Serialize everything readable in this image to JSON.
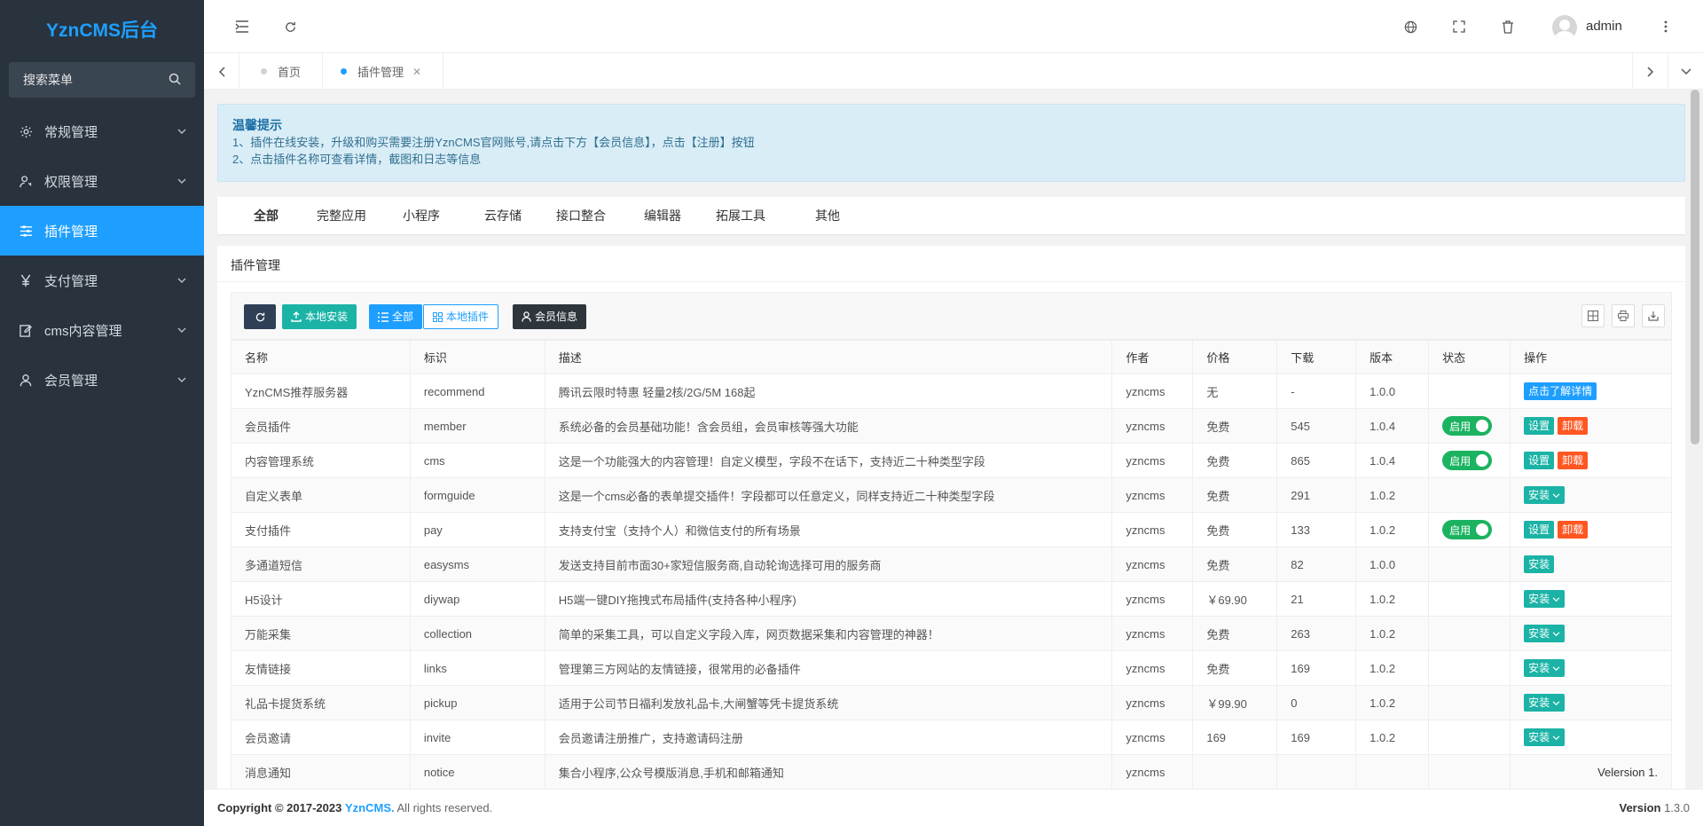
{
  "app": {
    "logo": "YznCMS后台"
  },
  "sidebar": {
    "search_placeholder": "搜索菜单",
    "items": [
      {
        "label": "常规管理",
        "icon": "gear-icon"
      },
      {
        "label": "权限管理",
        "icon": "user-key-icon"
      },
      {
        "label": "插件管理",
        "icon": "sliders-icon",
        "active": true
      },
      {
        "label": "支付管理",
        "icon": "yen-icon"
      },
      {
        "label": "cms内容管理",
        "icon": "edit-icon"
      },
      {
        "label": "会员管理",
        "icon": "user-icon"
      }
    ]
  },
  "header": {
    "user": "admin"
  },
  "tabs": [
    {
      "label": "首页"
    },
    {
      "label": "插件管理",
      "active": true
    }
  ],
  "notice": {
    "title": "温馨提示",
    "line1": "1、插件在线安装，升级和购买需要注册YznCMS官网账号,请点击下方【会员信息】，点击【注册】按钮",
    "line2": "2、点击插件名称可查看详情，截图和日志等信息"
  },
  "categories": [
    "全部",
    "完整应用",
    "小程序",
    "云存储",
    "接口整合",
    "编辑器",
    "拓展工具",
    "其他"
  ],
  "panel": {
    "title": "插件管理",
    "toolbar": {
      "local_install": "本地安装",
      "all": "全部",
      "local_plugins": "本地插件",
      "member_info": "会员信息"
    }
  },
  "table": {
    "headers": [
      "名称",
      "标识",
      "描述",
      "作者",
      "价格",
      "下载",
      "版本",
      "状态",
      "操作"
    ],
    "labels": {
      "enabled": "启用",
      "settings": "设置",
      "uninstall": "卸载",
      "install": "安装",
      "details": "点击了解详情"
    },
    "rows": [
      {
        "name": "YznCMS推荐服务器",
        "id": "recommend",
        "desc": "腾讯云限时特惠 轻量2核/2G/5M 168起",
        "author": "yzncms",
        "price": "无",
        "price_type": "none",
        "downloads": "-",
        "version": "1.0.0",
        "enabled": false,
        "action": "details"
      },
      {
        "name": "会员插件",
        "id": "member",
        "desc": "系统必备的会员基础功能！含会员组，会员审核等强大功能",
        "author": "yzncms",
        "price": "免费",
        "price_type": "free",
        "downloads": "545",
        "version": "1.0.4",
        "enabled": true,
        "action": "manage"
      },
      {
        "name": "内容管理系统",
        "id": "cms",
        "desc": "这是一个功能强大的内容管理！自定义模型，字段不在话下，支持近二十种类型字段",
        "author": "yzncms",
        "price": "免费",
        "price_type": "free",
        "downloads": "865",
        "version": "1.0.4",
        "enabled": true,
        "action": "manage"
      },
      {
        "name": "自定义表单",
        "id": "formguide",
        "desc": "这是一个cms必备的表单提交插件！字段都可以任意定义，同样支持近二十种类型字段",
        "author": "yzncms",
        "price": "免费",
        "price_type": "free",
        "downloads": "291",
        "version": "1.0.2",
        "enabled": false,
        "action": "install-dd"
      },
      {
        "name": "支付插件",
        "id": "pay",
        "desc": "支持支付宝（支持个人）和微信支付的所有场景",
        "author": "yzncms",
        "price": "免费",
        "price_type": "free",
        "downloads": "133",
        "version": "1.0.2",
        "enabled": true,
        "action": "manage"
      },
      {
        "name": "多通道短信",
        "id": "easysms",
        "desc": "发送支持目前市面30+家短信服务商,自动轮询选择可用的服务商",
        "author": "yzncms",
        "price": "免费",
        "price_type": "free",
        "downloads": "82",
        "version": "1.0.0",
        "enabled": false,
        "action": "install"
      },
      {
        "name": "H5设计",
        "id": "diywap",
        "desc": "H5端一键DIY拖拽式布局插件(支持各种小程序)",
        "author": "yzncms",
        "price": "￥69.90",
        "price_type": "paid",
        "downloads": "21",
        "version": "1.0.2",
        "enabled": false,
        "action": "install-dd"
      },
      {
        "name": "万能采集",
        "id": "collection",
        "desc": "简单的采集工具，可以自定义字段入库，网页数据采集和内容管理的神器！",
        "author": "yzncms",
        "price": "免费",
        "price_type": "free",
        "downloads": "263",
        "version": "1.0.2",
        "enabled": false,
        "action": "install-dd"
      },
      {
        "name": "友情链接",
        "id": "links",
        "desc": "管理第三方网站的友情链接，很常用的必备插件",
        "author": "yzncms",
        "price": "免费",
        "price_type": "free",
        "downloads": "169",
        "version": "1.0.2",
        "enabled": false,
        "action": "install-dd"
      },
      {
        "name": "礼品卡提货系统",
        "id": "pickup",
        "desc": "适用于公司节日福利发放礼品卡,大闸蟹等凭卡提货系统",
        "author": "yzncms",
        "price": "￥99.90",
        "price_type": "paid",
        "downloads": "0",
        "version": "1.0.2",
        "enabled": false,
        "action": "install-dd"
      },
      {
        "name": "会员邀请",
        "id": "invite",
        "desc": "会员邀请注册推广，支持邀请码注册",
        "author": "yzncms",
        "price": "169",
        "price_type": "none",
        "downloads": "169",
        "version": "1.0.2",
        "enabled": false,
        "action": "install-dd"
      },
      {
        "name": "消息通知",
        "id": "notice",
        "desc": "集合小程序,公众号模版消息,手机和邮箱通知",
        "author": "yzncms",
        "price": "",
        "price_type": "none",
        "downloads": "",
        "version": "",
        "enabled": false,
        "action": "version-note",
        "note": "Velersion 1."
      }
    ]
  },
  "footer": {
    "copyright": "Copyright © 2017-2023",
    "brand": "YznCMS.",
    "rights": "All rights reserved.",
    "version_label": "Version",
    "version": "1.3.0"
  }
}
